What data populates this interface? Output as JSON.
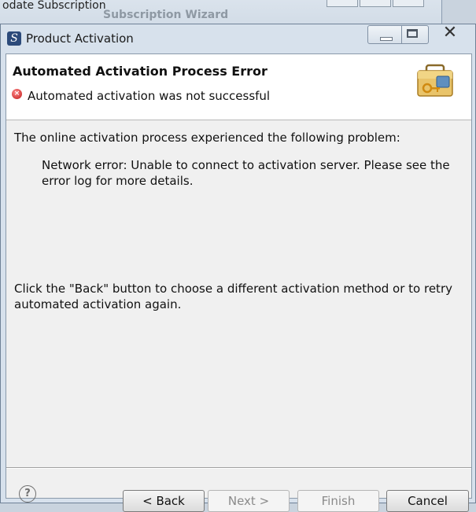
{
  "background_window": {
    "title": "odate Subscription",
    "ghost_title": "Subscription Wizard"
  },
  "dialog": {
    "title": "Product Activation",
    "app_icon_glyph": "S",
    "close_glyph": "✕"
  },
  "header": {
    "title": "Automated Activation Process Error",
    "status_message": "Automated activation was not successful",
    "status_icon": "error-icon",
    "image_icon": "briefcase-key-icon"
  },
  "content": {
    "intro": "The online activation process experienced the following problem:",
    "error_detail": "Network error: Unable to connect to activation server. Please see the error log for more details.",
    "instructions": "Click the \"Back\" button to choose a different activation method or to retry automated activation again."
  },
  "buttons": {
    "help_glyph": "?",
    "back": "< Back",
    "next": "Next >",
    "finish": "Finish",
    "cancel": "Cancel"
  },
  "colors": {
    "error_red": "#c01818",
    "client_bg": "#f0f0f0"
  }
}
